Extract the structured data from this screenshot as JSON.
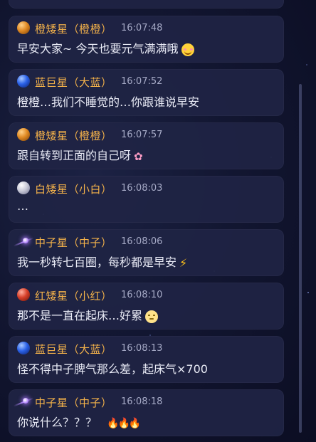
{
  "messages": [
    {
      "avatar": "orange-dwarf-avatar",
      "avatar_class": "av-orange",
      "name": "橙矮星（橙橙）",
      "time": "16:07:48",
      "text": "早安大家~ 今天也要元气满满哦",
      "emoji": "smiling-face-emoji"
    },
    {
      "avatar": "blue-giant-avatar",
      "avatar_class": "av-blue",
      "name": "蓝巨星（大蓝）",
      "time": "16:07:52",
      "text": "橙橙…我们不睡觉的…你跟谁说早安",
      "emoji": ""
    },
    {
      "avatar": "orange-dwarf-avatar",
      "avatar_class": "av-orange",
      "name": "橙矮星（橙橙）",
      "time": "16:07:57",
      "text": "跟自转到正面的自己呀",
      "emoji": "blossom-emoji"
    },
    {
      "avatar": "white-dwarf-avatar",
      "avatar_class": "av-white",
      "name": "白矮星（小白）",
      "time": "16:08:03",
      "text": "…",
      "emoji": ""
    },
    {
      "avatar": "neutron-star-avatar",
      "avatar_class": "av-neutron",
      "name": "中子星（中子）",
      "time": "16:08:06",
      "text": "我一秒转七百圈，每秒都是早安",
      "emoji": "lightning-emoji"
    },
    {
      "avatar": "red-dwarf-avatar",
      "avatar_class": "av-red",
      "name": "红矮星（小红）",
      "time": "16:08:10",
      "text": "那不是一直在起床…好累",
      "emoji": "sleepy-face-emoji"
    },
    {
      "avatar": "blue-giant-avatar",
      "avatar_class": "av-blue",
      "name": "蓝巨星（大蓝）",
      "time": "16:08:13",
      "text": "怪不得中子脾气那么差，起床气×700",
      "emoji": ""
    },
    {
      "avatar": "neutron-star-avatar",
      "avatar_class": "av-neutron",
      "name": "中子星（中子）",
      "time": "16:08:18",
      "text": "你说什么？？？",
      "emoji": "fire-emoji-x3"
    }
  ],
  "colors": {
    "background": "#121631",
    "card": "#20244a",
    "name": "#f4b24a",
    "time": "#a7abc7",
    "text": "#e9ebf6"
  }
}
